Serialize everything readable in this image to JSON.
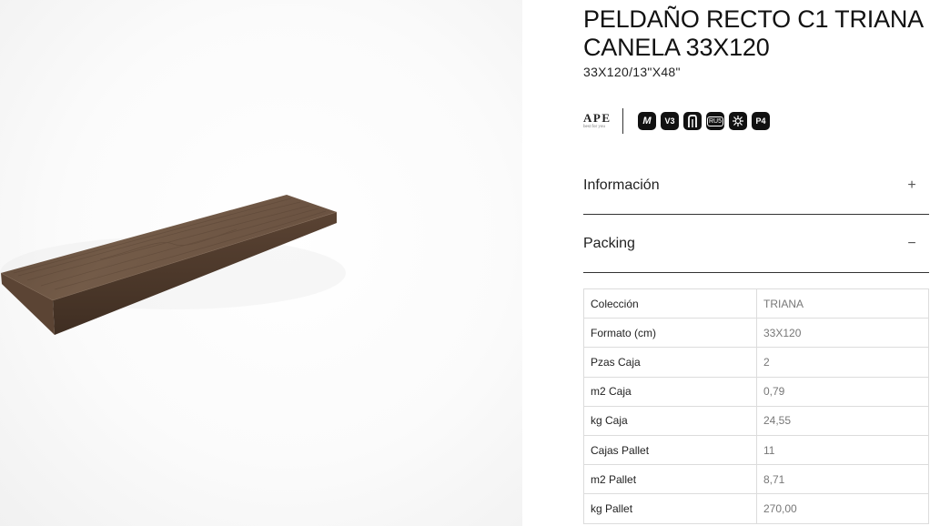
{
  "product": {
    "title": "PELDAÑO RECTO C1 TRIANA CANELA 33X120",
    "subtitle": "33X120/13\"X48\""
  },
  "brand": {
    "name": "APE",
    "tagline": "best for you"
  },
  "badges": [
    {
      "icon": "m-badge-icon",
      "text": "M"
    },
    {
      "icon": "v3-badge-icon",
      "text": "V3"
    },
    {
      "icon": "step-badge-icon",
      "text": ""
    },
    {
      "icon": "ru5-badge-icon",
      "text": "RU5"
    },
    {
      "icon": "frost-badge-icon",
      "text": ""
    },
    {
      "icon": "p4-badge-icon",
      "text": "P4"
    }
  ],
  "accordion": {
    "info_label": "Información",
    "info_toggle": "+",
    "packing_label": "Packing",
    "packing_toggle": "−"
  },
  "packing": [
    {
      "label": "Colección",
      "value": "TRIANA"
    },
    {
      "label": "Formato (cm)",
      "value": "33X120"
    },
    {
      "label": "Pzas Caja",
      "value": "2"
    },
    {
      "label": "m2 Caja",
      "value": "0,79"
    },
    {
      "label": "kg Caja",
      "value": "24,55"
    },
    {
      "label": "Cajas Pallet",
      "value": "11"
    },
    {
      "label": "m2 Pallet",
      "value": "8,71"
    },
    {
      "label": "kg Pallet",
      "value": "270,00"
    }
  ],
  "colors": {
    "wood_top": "#6d5645",
    "wood_edge": "#4e3a2c",
    "border": "#333333",
    "table_border": "#dcdcdc"
  }
}
